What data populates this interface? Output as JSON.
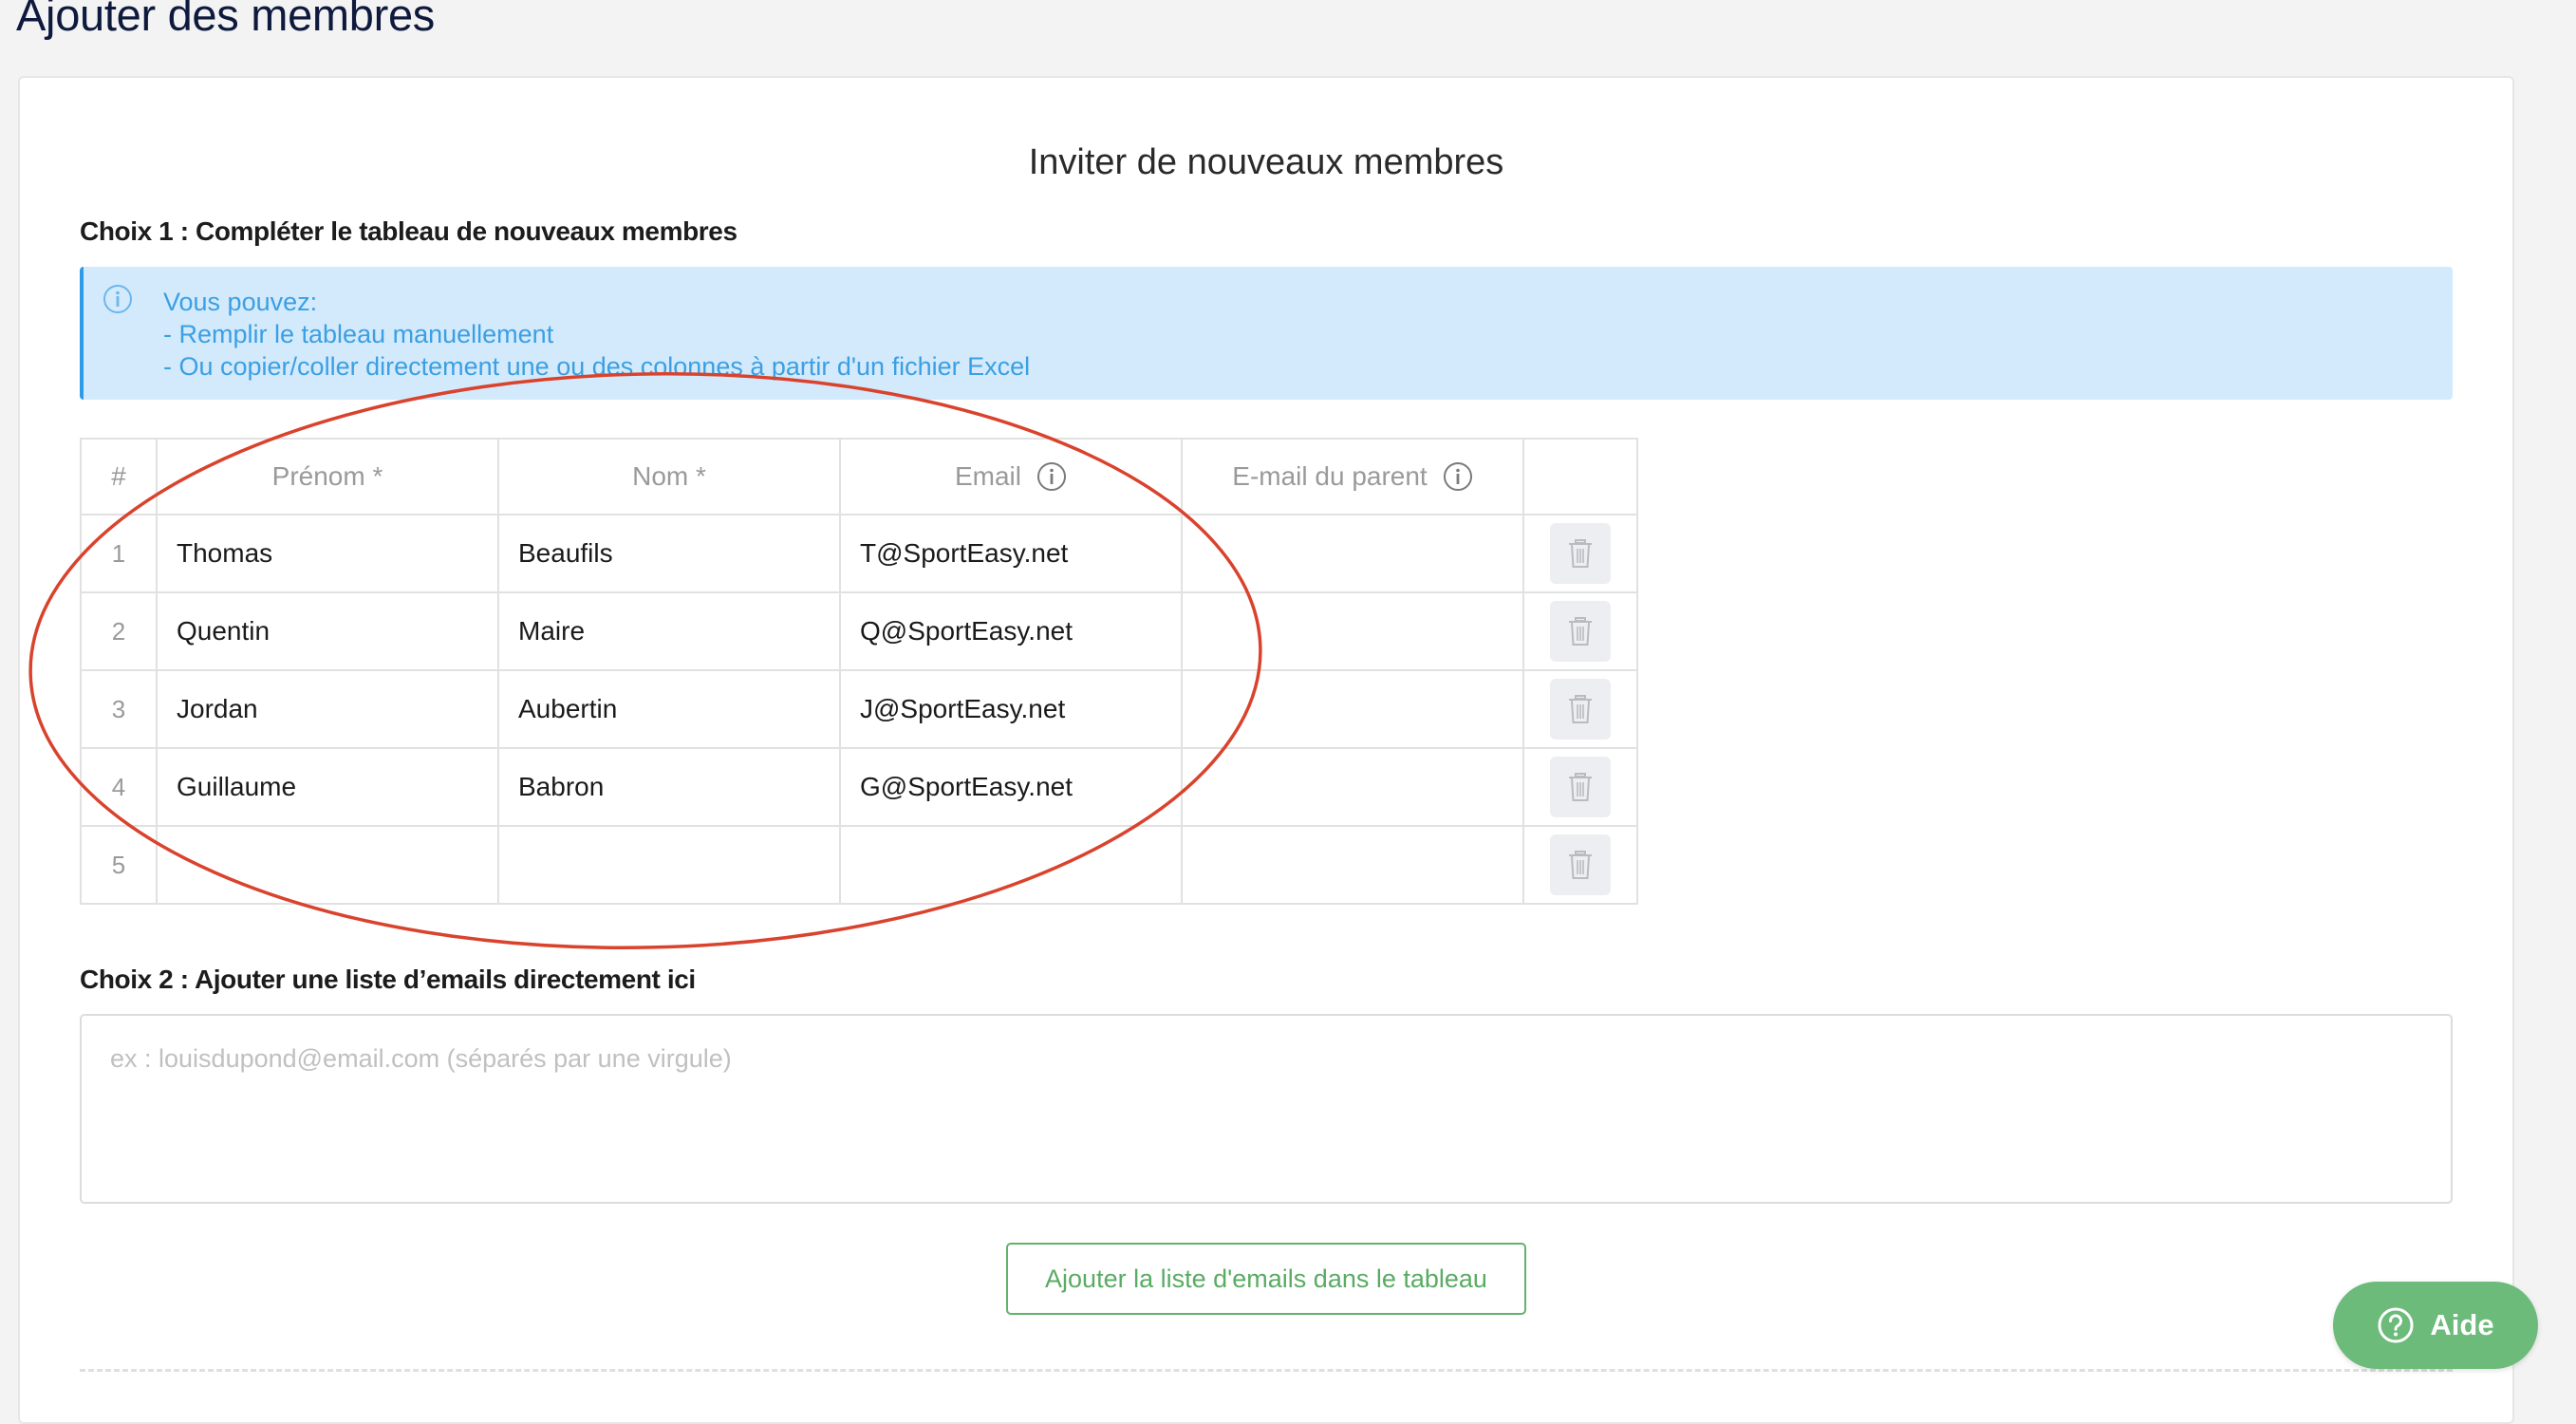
{
  "page": {
    "title": "Ajouter des membres"
  },
  "card": {
    "title": "Inviter de nouveaux membres"
  },
  "choice1": {
    "title": "Choix 1 : Compléter le tableau de nouveaux membres",
    "info_lines": [
      "Vous pouvez:",
      "- Remplir le tableau manuellement",
      "- Ou copier/coller directement une ou des colonnes à partir d'un fichier Excel"
    ]
  },
  "table": {
    "headers": {
      "num": "#",
      "first_name": "Prénom *",
      "last_name": "Nom *",
      "email": "Email",
      "parent_email": "E-mail du parent"
    },
    "rows": [
      {
        "num": "1",
        "first_name": "Thomas",
        "last_name": "Beaufils",
        "email": "T@SportEasy.net",
        "parent_email": ""
      },
      {
        "num": "2",
        "first_name": "Quentin",
        "last_name": "Maire",
        "email": "Q@SportEasy.net",
        "parent_email": ""
      },
      {
        "num": "3",
        "first_name": "Jordan",
        "last_name": "Aubertin",
        "email": "J@SportEasy.net",
        "parent_email": ""
      },
      {
        "num": "4",
        "first_name": "Guillaume",
        "last_name": "Babron",
        "email": "G@SportEasy.net",
        "parent_email": ""
      },
      {
        "num": "5",
        "first_name": "",
        "last_name": "",
        "email": "",
        "parent_email": ""
      }
    ]
  },
  "choice2": {
    "title": "Choix 2 : Ajouter une liste d’emails directement ici",
    "placeholder": "ex : louisdupond@email.com (séparés par une virgule)",
    "button_label": "Ajouter la liste d'emails dans le tableau"
  },
  "help": {
    "label": "Aide"
  },
  "colors": {
    "info_background": "#d3eafc",
    "info_text": "#3b9fe3",
    "accent_green": "#62b36b",
    "help_button": "#6cbb7a",
    "annotation_red": "#d9432d"
  }
}
